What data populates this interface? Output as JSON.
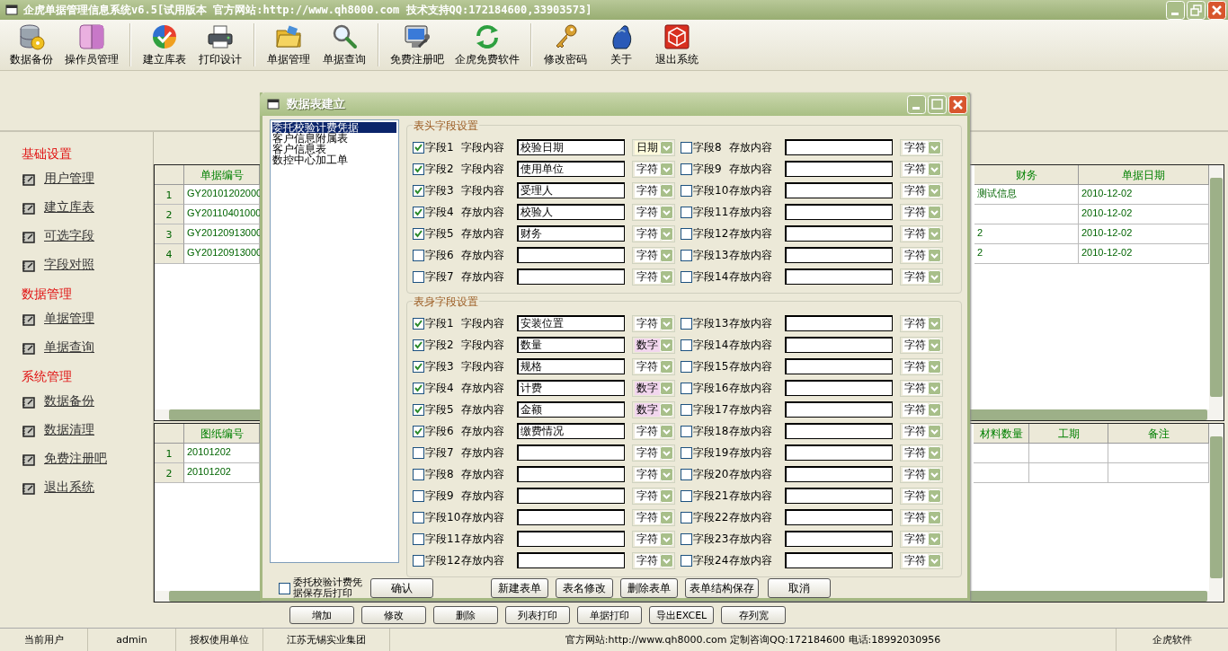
{
  "window": {
    "title": "企虎单据管理信息系统v6.5[试用版本 官方网站:http://www.qh8000.com 技术支持QQ:172184600,33903573]"
  },
  "toolbar": {
    "groups": [
      [
        "数据备份",
        "操作员管理"
      ],
      [
        "建立库表",
        "打印设计"
      ],
      [
        "单据管理",
        "单据查询"
      ],
      [
        "免费注册吧",
        "企虎免费软件"
      ],
      [
        "修改密码",
        "关于",
        "退出系统"
      ]
    ]
  },
  "sidebar": {
    "sections": [
      {
        "title": "基础设置",
        "items": [
          "用户管理",
          "建立库表",
          "可选字段",
          "字段对照"
        ]
      },
      {
        "title": "数据管理",
        "items": [
          "单据管理",
          "单据查询"
        ]
      },
      {
        "title": "系统管理",
        "items": [
          "数据备份",
          "数据清理",
          "免费注册吧",
          "退出系统"
        ]
      }
    ]
  },
  "upper_table": {
    "columns": [
      "单据编号",
      "财务",
      "单据日期"
    ],
    "rows": [
      {
        "number": "1",
        "cells": [
          "GY20101202000",
          "测试信息",
          "2010-12-02"
        ]
      },
      {
        "number": "2",
        "cells": [
          "GY20110401000",
          null,
          "2010-12-02"
        ]
      },
      {
        "number": "3",
        "cells": [
          "GY20120913000",
          "2",
          "2010-12-02"
        ]
      },
      {
        "number": "4",
        "cells": [
          "GY20120913000",
          "2",
          "2010-12-02"
        ]
      }
    ]
  },
  "lower_table": {
    "columns": [
      "图纸编号",
      "材料数量",
      "工期",
      "备注"
    ],
    "rows": [
      {
        "number": "1",
        "cells": [
          "20101202",
          null,
          null,
          null
        ]
      },
      {
        "number": "2",
        "cells": [
          "20101202",
          null,
          null,
          null
        ]
      }
    ]
  },
  "action_buttons": [
    "增加",
    "修改",
    "删除",
    "列表打印",
    "单据打印",
    "导出EXCEL",
    "存列宽"
  ],
  "status_bar": [
    "当前用户",
    "admin",
    "授权使用单位",
    "江苏无锡实业集团",
    "官方网站:http://www.qh8000.com 定制咨询QQ:172184600 电话:18992030956",
    "企虎软件"
  ],
  "dialog": {
    "title": "数据表建立",
    "tables": [
      {
        "label": "委托校验计费凭据",
        "selected": true
      },
      {
        "label": "客户信息附属表",
        "selected": false
      },
      {
        "label": "客户信息表",
        "selected": false
      },
      {
        "label": "数控中心加工单",
        "selected": false
      }
    ],
    "sections": [
      {
        "title": "表头字段设置",
        "left": [
          {
            "checked": true,
            "label": "字段1",
            "caption": "字段内容",
            "value": "校验日期",
            "type": "日期",
            "kind": "date"
          },
          {
            "checked": true,
            "label": "字段2",
            "caption": "字段内容",
            "value": "使用单位",
            "type": "字符",
            "kind": "text"
          },
          {
            "checked": true,
            "label": "字段3",
            "caption": "字段内容",
            "value": "受理人",
            "type": "字符",
            "kind": "text"
          },
          {
            "checked": true,
            "label": "字段4",
            "caption": "存放内容",
            "value": "校验人",
            "type": "字符",
            "kind": "text"
          },
          {
            "checked": true,
            "label": "字段5",
            "caption": "存放内容",
            "value": "财务",
            "type": "字符",
            "kind": "text"
          },
          {
            "checked": false,
            "label": "字段6",
            "caption": "存放内容",
            "type": "字符",
            "kind": "text"
          },
          {
            "checked": false,
            "label": "字段7",
            "caption": "存放内容",
            "type": "字符",
            "kind": "text"
          }
        ],
        "right": [
          {
            "checked": false,
            "label": "字段8",
            "caption": "存放内容",
            "type": "字符",
            "kind": "text"
          },
          {
            "checked": false,
            "label": "字段9",
            "caption": "存放内容",
            "type": "字符",
            "kind": "text"
          },
          {
            "checked": false,
            "label": "字段10",
            "caption": "存放内容",
            "type": "字符",
            "kind": "text"
          },
          {
            "checked": false,
            "label": "字段11",
            "caption": "存放内容",
            "type": "字符",
            "kind": "text"
          },
          {
            "checked": false,
            "label": "字段12",
            "caption": "存放内容",
            "type": "字符",
            "kind": "text"
          },
          {
            "checked": false,
            "label": "字段13",
            "caption": "存放内容",
            "type": "字符",
            "kind": "text"
          },
          {
            "checked": false,
            "label": "字段14",
            "caption": "存放内容",
            "type": "字符",
            "kind": "text"
          }
        ]
      },
      {
        "title": "表身字段设置",
        "left": [
          {
            "checked": true,
            "label": "字段1",
            "caption": "字段内容",
            "value": "安装位置",
            "type": "字符",
            "kind": "text"
          },
          {
            "checked": true,
            "label": "字段2",
            "caption": "字段内容",
            "value": "数量",
            "type": "数字",
            "kind": "number"
          },
          {
            "checked": true,
            "label": "字段3",
            "caption": "字段内容",
            "value": "规格",
            "type": "字符",
            "kind": "text"
          },
          {
            "checked": true,
            "label": "字段4",
            "caption": "存放内容",
            "value": "计费",
            "type": "数字",
            "kind": "number"
          },
          {
            "checked": true,
            "label": "字段5",
            "caption": "存放内容",
            "value": "金额",
            "type": "数字",
            "kind": "number"
          },
          {
            "checked": true,
            "label": "字段6",
            "caption": "存放内容",
            "value": "缴费情况",
            "type": "字符",
            "kind": "text"
          },
          {
            "checked": false,
            "label": "字段7",
            "caption": "存放内容",
            "type": "字符",
            "kind": "text"
          },
          {
            "checked": false,
            "label": "字段8",
            "caption": "存放内容",
            "type": "字符",
            "kind": "text"
          },
          {
            "checked": false,
            "label": "字段9",
            "caption": "存放内容",
            "type": "字符",
            "kind": "text"
          },
          {
            "checked": false,
            "label": "字段10",
            "caption": "存放内容",
            "type": "字符",
            "kind": "text"
          },
          {
            "checked": false,
            "label": "字段11",
            "caption": "存放内容",
            "type": "字符",
            "kind": "text"
          },
          {
            "checked": false,
            "label": "字段12",
            "caption": "存放内容",
            "type": "字符",
            "kind": "text"
          }
        ],
        "right": [
          {
            "checked": false,
            "label": "字段13",
            "caption": "存放内容",
            "type": "字符",
            "kind": "text"
          },
          {
            "checked": false,
            "label": "字段14",
            "caption": "存放内容",
            "type": "字符",
            "kind": "text"
          },
          {
            "checked": false,
            "label": "字段15",
            "caption": "存放内容",
            "type": "字符",
            "kind": "text"
          },
          {
            "checked": false,
            "label": "字段16",
            "caption": "存放内容",
            "type": "字符",
            "kind": "text"
          },
          {
            "checked": false,
            "label": "字段17",
            "caption": "存放内容",
            "type": "字符",
            "kind": "text"
          },
          {
            "checked": false,
            "label": "字段18",
            "caption": "存放内容",
            "type": "字符",
            "kind": "text"
          },
          {
            "checked": false,
            "label": "字段19",
            "caption": "存放内容",
            "type": "字符",
            "kind": "text"
          },
          {
            "checked": false,
            "label": "字段20",
            "caption": "存放内容",
            "type": "字符",
            "kind": "text"
          },
          {
            "checked": false,
            "label": "字段21",
            "caption": "存放内容",
            "type": "字符",
            "kind": "text"
          },
          {
            "checked": false,
            "label": "字段22",
            "caption": "存放内容",
            "type": "字符",
            "kind": "text"
          },
          {
            "checked": false,
            "label": "字段23",
            "caption": "存放内容",
            "type": "字符",
            "kind": "text"
          },
          {
            "checked": false,
            "label": "字段24",
            "caption": "存放内容",
            "type": "字符",
            "kind": "text"
          }
        ]
      }
    ],
    "print_option": {
      "label": "委托校验计费凭据保存后打印",
      "checked": false
    },
    "confirm": "确认",
    "buttons": [
      "新建表单",
      "表名修改",
      "删除表单",
      "表单结构保存",
      "取消"
    ]
  }
}
